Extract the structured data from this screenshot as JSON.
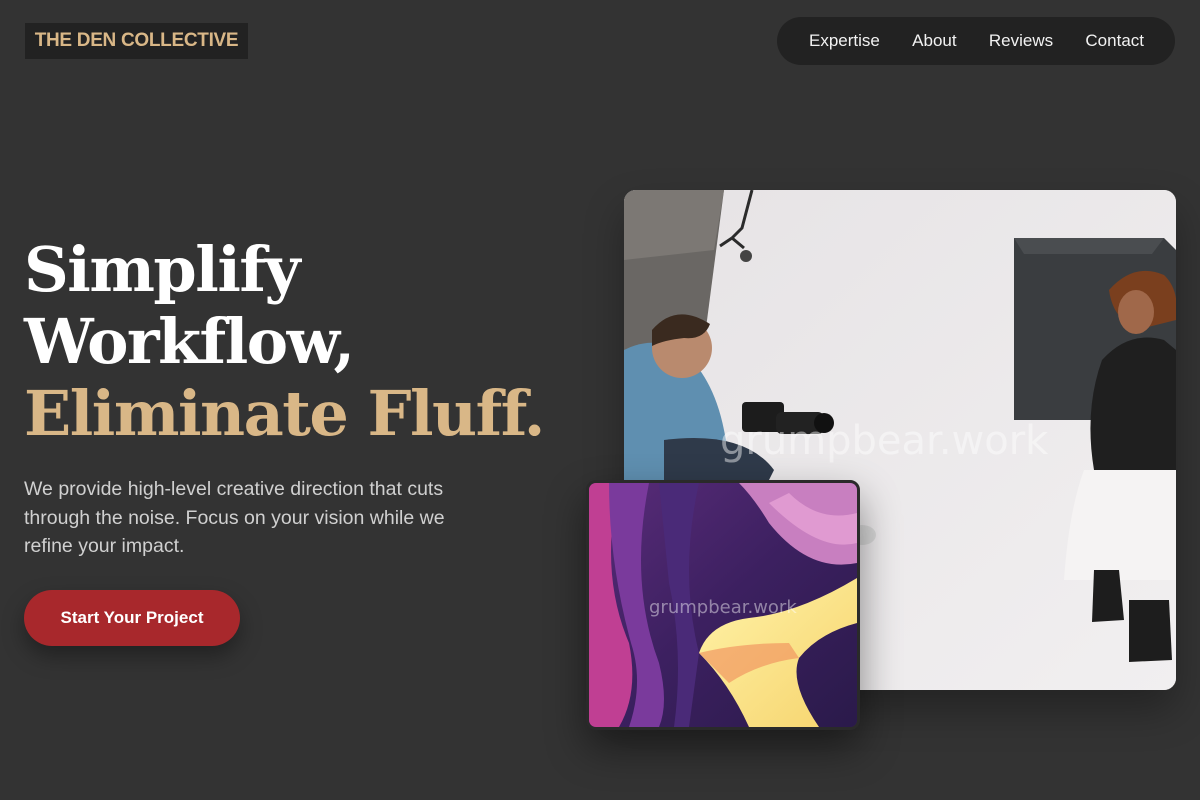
{
  "brand": {
    "logo_text": "THE DEN COLLECTIVE"
  },
  "nav": {
    "items": [
      {
        "label": "Expertise"
      },
      {
        "label": "About"
      },
      {
        "label": "Reviews"
      },
      {
        "label": "Contact"
      }
    ]
  },
  "hero": {
    "title_line_1": "Simplify",
    "title_line_2": "Workflow,",
    "title_line_3": "Eliminate Fluff.",
    "subtitle": "We provide high-level creative direction that cuts through the noise. Focus on your vision while we refine your impact.",
    "cta_label": "Start Your Project"
  },
  "images": {
    "main_watermark": "grumpbear.work",
    "abstract_watermark": "grumpbear.work"
  },
  "colors": {
    "background": "#333333",
    "accent_gold": "#d9b787",
    "cta_red": "#a8282c",
    "dark_panel": "#222222"
  }
}
